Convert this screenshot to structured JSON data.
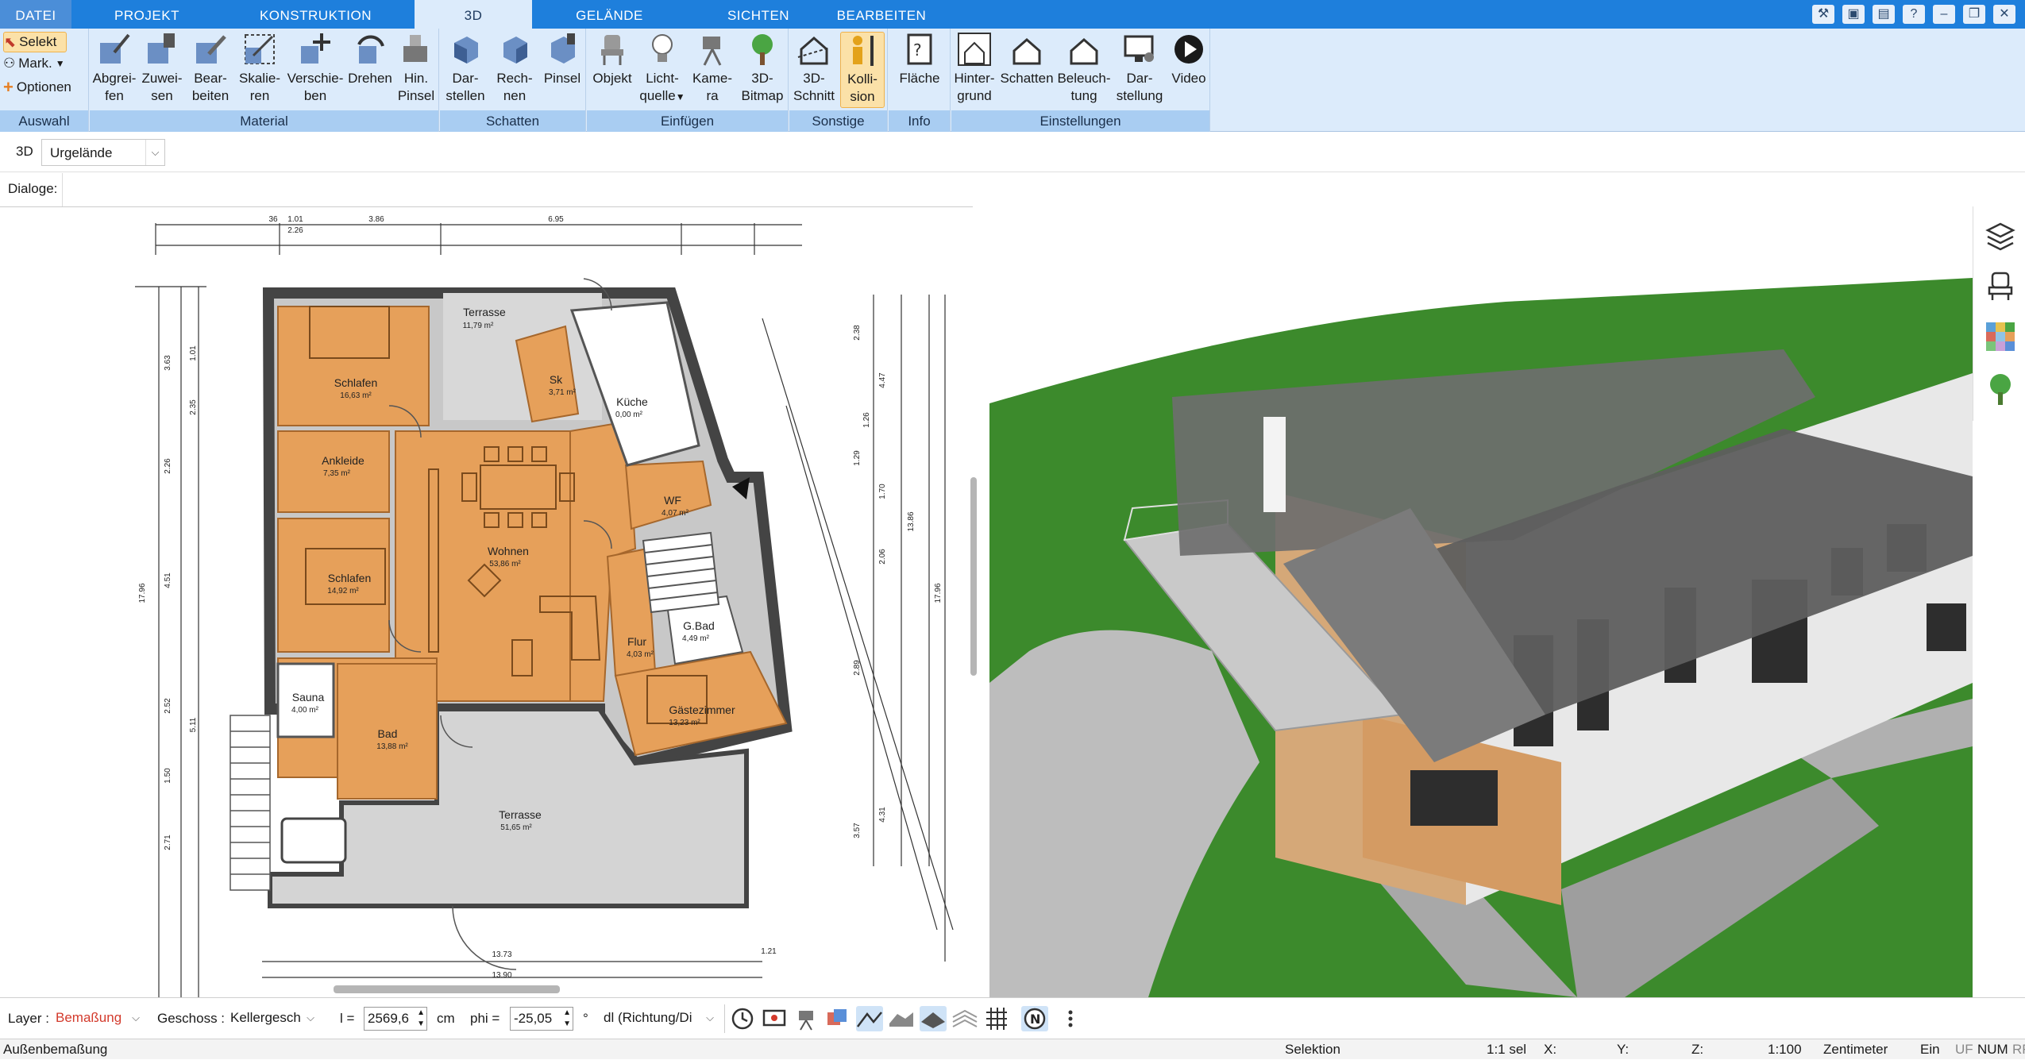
{
  "tabs": [
    {
      "label": "DATEI"
    },
    {
      "label": "PROJEKT"
    },
    {
      "label": "KONSTRUKTION"
    },
    {
      "label": "3D"
    },
    {
      "label": "GELÄNDE"
    },
    {
      "label": "SICHTEN"
    },
    {
      "label": "BEARBEITEN"
    }
  ],
  "ribbon": {
    "auswahl": {
      "title": "Auswahl",
      "selekt": "Selekt",
      "mark": "Mark.",
      "optionen": "Optionen"
    },
    "material": {
      "title": "Material",
      "buttons": [
        {
          "l1": "Abgrei-",
          "l2": "fen"
        },
        {
          "l1": "Zuwei-",
          "l2": "sen"
        },
        {
          "l1": "Bear-",
          "l2": "beiten"
        },
        {
          "l1": "Skalie-",
          "l2": "ren"
        },
        {
          "l1": "Verschie-",
          "l2": "ben"
        },
        {
          "l1": "Drehen",
          "l2": ""
        },
        {
          "l1": "Hin.",
          "l2": "Pinsel"
        }
      ]
    },
    "schatten": {
      "title": "Schatten",
      "buttons": [
        {
          "l1": "Dar-",
          "l2": "stellen"
        },
        {
          "l1": "Rech-",
          "l2": "nen"
        },
        {
          "l1": "Pinsel",
          "l2": ""
        }
      ]
    },
    "einfuegen": {
      "title": "Einfügen",
      "buttons": [
        {
          "l1": "Objekt",
          "l2": ""
        },
        {
          "l1": "Licht-",
          "l2": "quelle"
        },
        {
          "l1": "Kame-",
          "l2": "ra"
        },
        {
          "l1": "3D-",
          "l2": "Bitmap"
        }
      ]
    },
    "sonstige": {
      "title": "Sonstige",
      "buttons": [
        {
          "l1": "3D-",
          "l2": "Schnitt"
        },
        {
          "l1": "Kolli-",
          "l2": "sion"
        }
      ]
    },
    "info": {
      "title": "Info",
      "buttons": [
        {
          "l1": "Fläche",
          "l2": ""
        }
      ]
    },
    "einstellungen": {
      "title": "Einstellungen",
      "buttons": [
        {
          "l1": "Hinter-",
          "l2": "grund"
        },
        {
          "l1": "Schatten",
          "l2": ""
        },
        {
          "l1": "Beleuch-",
          "l2": "tung"
        },
        {
          "l1": "Dar-",
          "l2": "stellung"
        },
        {
          "l1": "Video",
          "l2": ""
        }
      ]
    }
  },
  "view": {
    "mode": "3D",
    "selected": "Urgelände"
  },
  "dialoge_label": "Dialoge:",
  "plan": {
    "rooms": [
      {
        "name": "Terrasse",
        "area": "11,79 m²"
      },
      {
        "name": "Schlafen",
        "area": "16,63 m²"
      },
      {
        "name": "Sk",
        "area": "3,71 m²"
      },
      {
        "name": "Küche",
        "area": "0,00 m²"
      },
      {
        "name": "Ankleide",
        "area": "7,35 m²"
      },
      {
        "name": "WF",
        "area": "4,07 m²"
      },
      {
        "name": "Wohnen",
        "area": "53,86 m²"
      },
      {
        "name": "Schlafen",
        "area": "14,92 m²"
      },
      {
        "name": "G.Bad",
        "area": "4,49 m²"
      },
      {
        "name": "Flur",
        "area": "4,03 m²"
      },
      {
        "name": "Sauna",
        "area": "4,00 m²"
      },
      {
        "name": "Bad",
        "area": "13,88 m²"
      },
      {
        "name": "Gästezimmer",
        "area": "13,23 m²"
      },
      {
        "name": "Terrasse",
        "area": "51,65 m²"
      }
    ],
    "dims_top": [
      "36",
      "1.01",
      "2.26",
      "3.86",
      "6.95"
    ],
    "dims_left": [
      "17.96",
      "3.63",
      "1.01",
      "2.35",
      "2.26",
      "4.51",
      "2.52",
      "1.50",
      "2.71",
      "5.11"
    ],
    "dims_right": [
      "2.38",
      "4.47",
      "1.26",
      "1.29",
      "1.70",
      "13.86",
      "2.06",
      "17.96",
      "2.89",
      "3.57",
      "4.31"
    ],
    "dims_bottom": [
      "13.73",
      "13.90",
      "1.21"
    ]
  },
  "toolbar2": {
    "layer_label": "Layer :",
    "layer_value": "Bemaßung",
    "geschoss_label": "Geschoss :",
    "geschoss_value": "Kellergesch",
    "l_label": "l =",
    "l_value": "2569,6",
    "l_unit": "cm",
    "phi_label": "phi =",
    "phi_value": "-25,05",
    "phi_unit": "°",
    "dl_value": "dl (Richtung/Di"
  },
  "status": {
    "left": "Außenbemaßung",
    "mode": "Selektion",
    "sel": "1:1 sel",
    "x": "X:",
    "y": "Y:",
    "z": "Z:",
    "scale": "1:100",
    "unit": "Zentimeter",
    "ein": "Ein",
    "uf": "UF",
    "num": "NUM",
    "rf": "RF"
  },
  "colors": {
    "ribbon_tab_bar": "#1e7fdc",
    "ribbon_bg": "#dcebfb",
    "group_label": "#a9cdf2",
    "floor_wood": "#e6a05a",
    "grass": "#3c8a2c",
    "roof": "#6a6a6a"
  }
}
